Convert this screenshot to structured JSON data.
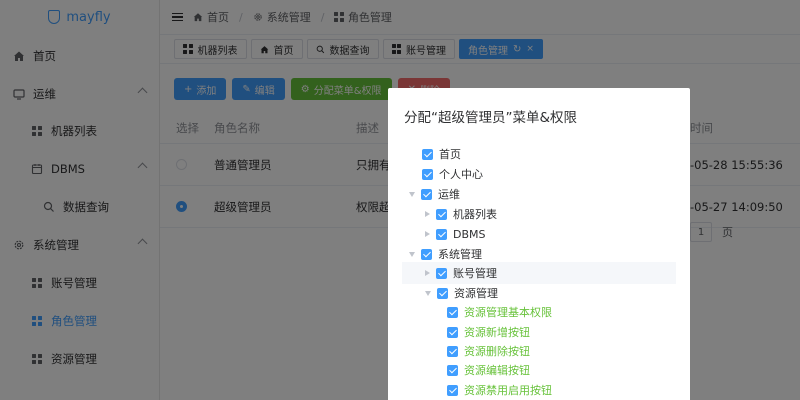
{
  "app": {
    "name": "mayfly"
  },
  "sidebar": {
    "items": [
      {
        "label": "首页",
        "icon": "home-icon"
      },
      {
        "label": "运维",
        "icon": "monitor-icon",
        "expanded": true
      },
      {
        "label": "机器列表",
        "icon": "grid-icon"
      },
      {
        "label": "DBMS",
        "icon": "calendar-icon",
        "expanded": true
      },
      {
        "label": "数据查询",
        "icon": "search-icon"
      },
      {
        "label": "系统管理",
        "icon": "gear-icon",
        "expanded": true
      },
      {
        "label": "账号管理",
        "icon": "grid-icon"
      },
      {
        "label": "角色管理",
        "icon": "grid-icon",
        "active": true
      },
      {
        "label": "资源管理",
        "icon": "grid-icon"
      }
    ]
  },
  "breadcrumb": [
    "首页",
    "系统管理",
    "角色管理"
  ],
  "tabs": [
    {
      "label": "机器列表",
      "icon": "grid-icon"
    },
    {
      "label": "首页",
      "icon": "home-icon"
    },
    {
      "label": "数据查询",
      "icon": "search-icon"
    },
    {
      "label": "账号管理",
      "icon": "grid-icon"
    },
    {
      "label": "角色管理",
      "active": true,
      "refresh": "↻",
      "close": "×"
    }
  ],
  "toolbar": {
    "add": "添加",
    "edit": "编辑",
    "assign": "分配菜单&权限",
    "delete": "删除"
  },
  "table": {
    "headers": {
      "select": "选择",
      "name": "角色名称",
      "desc": "描述",
      "time": "时间"
    },
    "rows": [
      {
        "name": "普通管理员",
        "desc": "只拥有",
        "time": "-05-28 15:55:36",
        "selected": false
      },
      {
        "name": "超级管理员",
        "desc": "权限超",
        "time": "-05-27 14:09:50",
        "selected": true
      }
    ],
    "pager": {
      "page": "1",
      "suffix": "页"
    }
  },
  "dialog": {
    "title": "分配“超级管理员”菜单&权限",
    "nodes": [
      {
        "label": "首页",
        "caret": "none",
        "level": 0
      },
      {
        "label": "个人中心",
        "caret": "none",
        "level": 0
      },
      {
        "label": "运维",
        "caret": "down",
        "level": 0
      },
      {
        "label": "机器列表",
        "caret": "right",
        "level": 1
      },
      {
        "label": "DBMS",
        "caret": "right",
        "level": 1
      },
      {
        "label": "系统管理",
        "caret": "down",
        "level": 0
      },
      {
        "label": "账号管理",
        "caret": "right",
        "level": 1,
        "highlight": true
      },
      {
        "label": "资源管理",
        "caret": "down",
        "level": 1
      },
      {
        "label": "资源管理基本权限",
        "caret": "none",
        "level": 2,
        "perm": true
      },
      {
        "label": "资源新增按钮",
        "caret": "none",
        "level": 2,
        "perm": true
      },
      {
        "label": "资源删除按钮",
        "caret": "none",
        "level": 2,
        "perm": true
      },
      {
        "label": "资源编辑按钮",
        "caret": "none",
        "level": 2,
        "perm": true
      },
      {
        "label": "资源禁用启用按钮",
        "caret": "none",
        "level": 2,
        "perm": true
      }
    ]
  },
  "colors": {
    "primary": "#409eff",
    "success": "#67c23a",
    "danger": "#f56c6c"
  }
}
